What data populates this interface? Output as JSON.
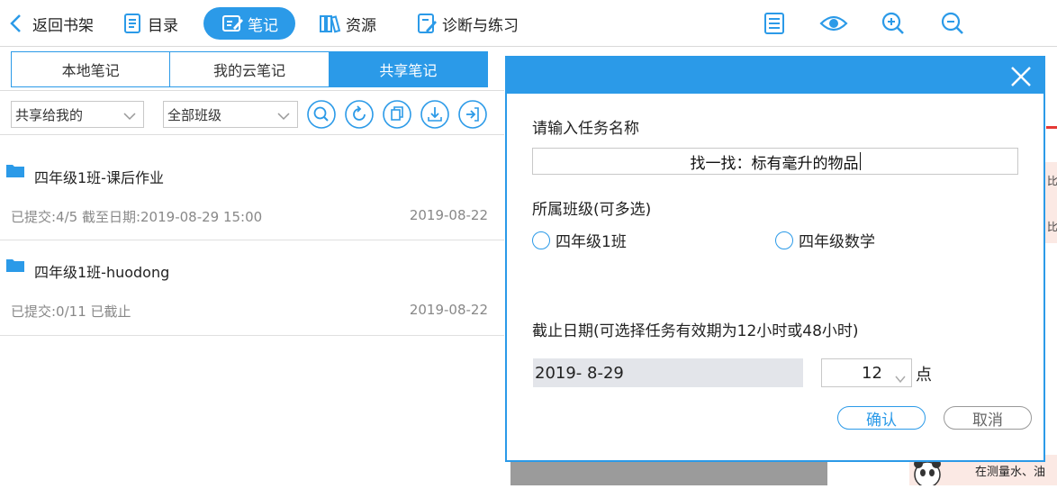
{
  "toolbar": {
    "back": "返回书架",
    "toc": "目录",
    "notes": "笔记",
    "resources": "资源",
    "diagnose": "诊断与练习",
    "right_icons": [
      "outline-icon",
      "eye-icon",
      "zoom-in-icon",
      "zoom-out-icon"
    ],
    "accent": "#2b9ae8"
  },
  "tabs": [
    {
      "label": "本地笔记",
      "active": false
    },
    {
      "label": "我的云笔记",
      "active": false
    },
    {
      "label": "共享笔记",
      "active": true
    }
  ],
  "filters": {
    "share_scope": "共享给我的",
    "class_scope": "全部班级",
    "actions": [
      "search-icon",
      "refresh-icon",
      "copy-icon",
      "download-icon",
      "exit-icon"
    ]
  },
  "notes": [
    {
      "title": "四年级1班-课后作业",
      "meta": "已提交:4/5 截至日期:2019-08-29 15:00",
      "date": "2019-08-22"
    },
    {
      "title": "四年级1班-huodong",
      "meta": "已提交:0/11 已截止",
      "date": "2019-08-22"
    }
  ],
  "right_page": {
    "peek1": "比",
    "peek2": "比",
    "caption": "在测量水、油"
  },
  "dialog": {
    "task_label": "请输入任务名称",
    "task_value": "找一找：标有毫升的物品",
    "class_label": "所属班级(可多选)",
    "classes": [
      "四年级1班",
      "四年级数学"
    ],
    "deadline_label": "截止日期(可选择任务有效期为12小时或48小时)",
    "date_value": "2019- 8-29",
    "hour_value": "12",
    "hour_unit": "点",
    "ok": "确认",
    "cancel": "取消"
  }
}
